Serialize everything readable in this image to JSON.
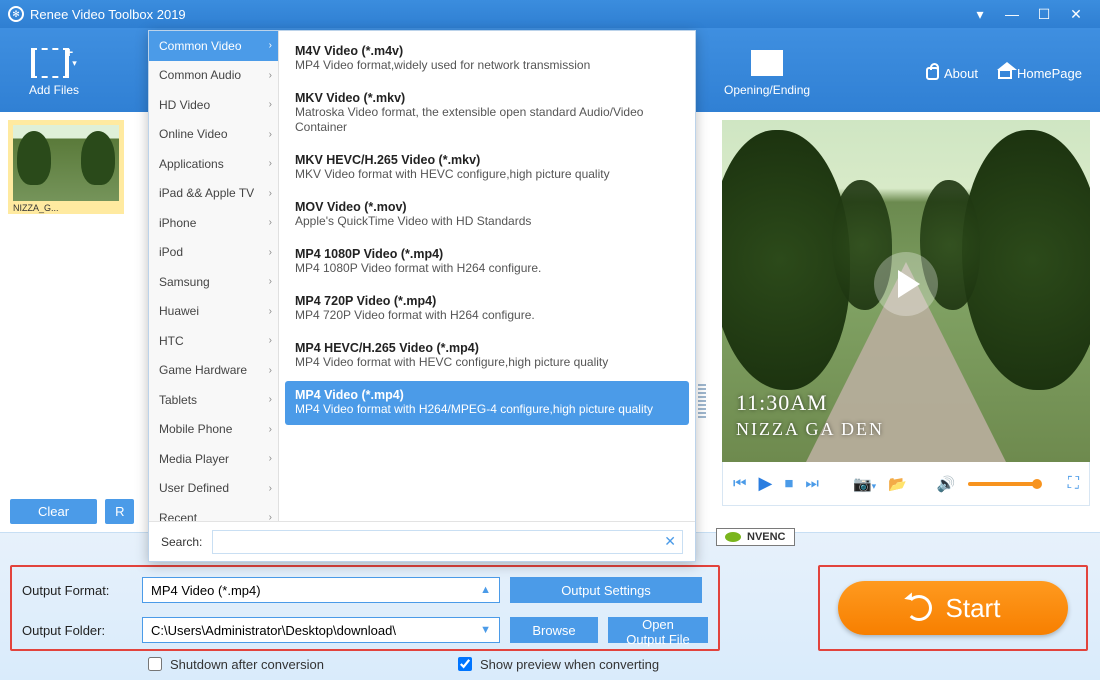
{
  "title": "Renee Video Toolbox 2019",
  "topLinks": {
    "about": "About",
    "home": "HomePage"
  },
  "toolbar": {
    "addFiles": "Add Files",
    "openingEnding": "Opening/Ending"
  },
  "thumb": {
    "caption": "NIZZA_G..."
  },
  "leftButtons": {
    "clear": "Clear",
    "remove": "R"
  },
  "preview": {
    "time": "11:30AM",
    "place": "NIZZA GA   DEN"
  },
  "nvenc": "NVENC",
  "dropdown": {
    "searchLabel": "Search:",
    "searchPlaceholder": "",
    "categories": [
      "Common Video",
      "Common Audio",
      "HD Video",
      "Online Video",
      "Applications",
      "iPad && Apple TV",
      "iPhone",
      "iPod",
      "Samsung",
      "Huawei",
      "HTC",
      "Game Hardware",
      "Tablets",
      "Mobile Phone",
      "Media Player",
      "User Defined",
      "Recent"
    ],
    "selectedCategory": 0,
    "items": [
      {
        "t": "M4V Video (*.m4v)",
        "d": "MP4 Video format,widely used for network transmission"
      },
      {
        "t": "MKV Video (*.mkv)",
        "d": "Matroska Video format, the extensible open standard Audio/Video Container"
      },
      {
        "t": "MKV HEVC/H.265 Video (*.mkv)",
        "d": "MKV Video format with HEVC configure,high picture quality"
      },
      {
        "t": "MOV Video (*.mov)",
        "d": "Apple's QuickTime Video with HD Standards"
      },
      {
        "t": "MP4 1080P Video (*.mp4)",
        "d": "MP4 1080P Video format with H264 configure."
      },
      {
        "t": "MP4 720P Video (*.mp4)",
        "d": "MP4 720P Video format with H264 configure."
      },
      {
        "t": "MP4 HEVC/H.265 Video (*.mp4)",
        "d": "MP4 Video format with HEVC configure,high picture quality"
      },
      {
        "t": "MP4 Video (*.mp4)",
        "d": "MP4 Video format with H264/MPEG-4 configure,high picture quality",
        "active": true
      }
    ]
  },
  "output": {
    "formatLabel": "Output Format:",
    "formatValue": "MP4 Video (*.mp4)",
    "settingsBtn": "Output Settings",
    "folderLabel": "Output Folder:",
    "folderValue": "C:\\Users\\Administrator\\Desktop\\download\\",
    "browseBtn": "Browse",
    "openBtn": "Open Output File"
  },
  "checks": {
    "shutdown": "Shutdown after conversion",
    "preview": "Show preview when converting"
  },
  "start": "Start"
}
